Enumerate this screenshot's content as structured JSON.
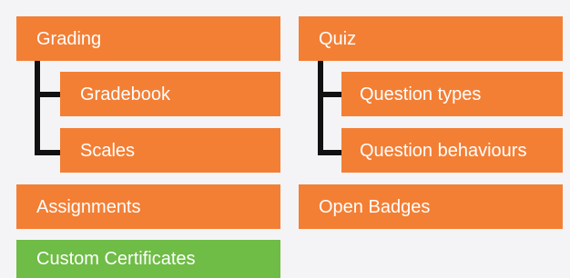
{
  "colors": {
    "primary": "#f37f35",
    "highlight": "#6fbc46",
    "connector": "#111111",
    "background": "#f4f4f6"
  },
  "left": {
    "parent": "Grading",
    "children": [
      "Gradebook",
      "Scales"
    ],
    "after": [
      "Assignments",
      "Custom Certificates"
    ]
  },
  "right": {
    "parent": "Quiz",
    "children": [
      "Question types",
      "Question behaviours"
    ],
    "after": [
      "Open Badges"
    ]
  }
}
